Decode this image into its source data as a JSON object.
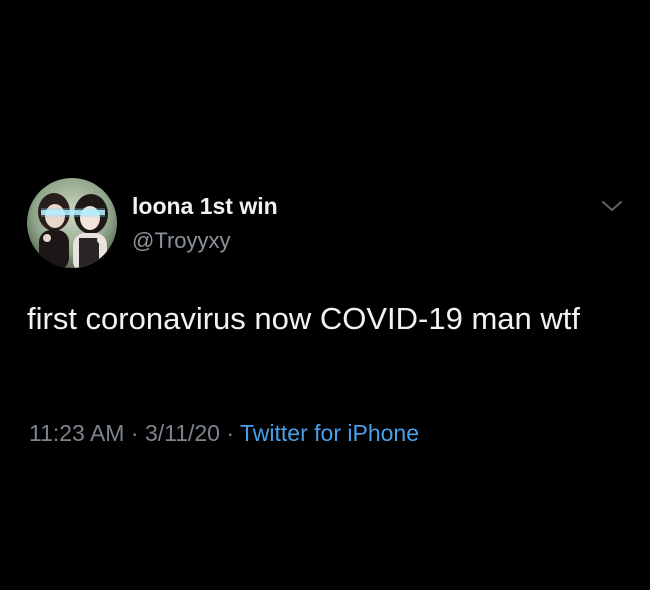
{
  "tweet": {
    "display_name": "loona 1st win",
    "handle": "@Troyyxy",
    "text": "first coronavirus now COVID-19 man wtf",
    "time": "11:23 AM",
    "separator": "·",
    "date": "3/11/20",
    "source": "Twitter for iPhone"
  },
  "icons": {
    "menu": "chevron-down-icon",
    "avatar": "profile-photo"
  },
  "colors": {
    "background": "#000000",
    "text": "#f2f2f2",
    "muted": "#7d848b",
    "link": "#4a9fe8"
  }
}
